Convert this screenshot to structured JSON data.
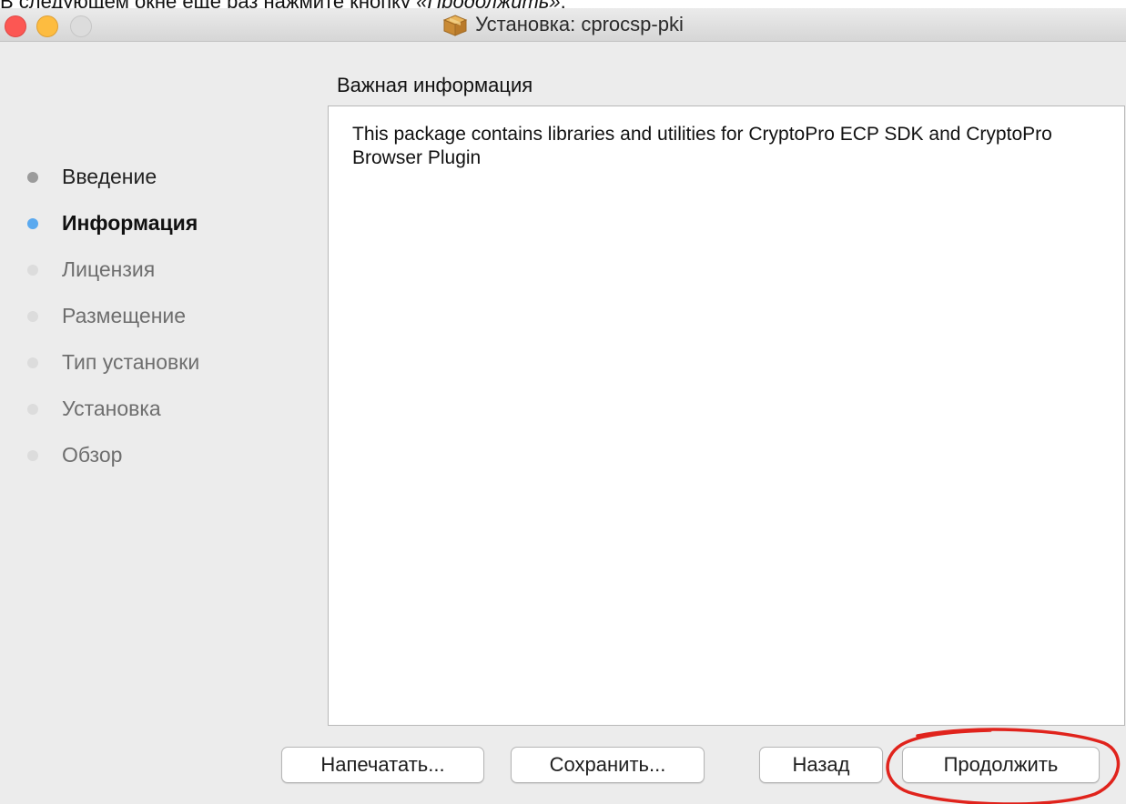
{
  "document": {
    "caption_start": "В следующем окне ещё раз нажмите кнопку ",
    "caption_emphasis": "«Продолжить»",
    "caption_end": "."
  },
  "window": {
    "title": "Установка: cprocsp-pki",
    "icon": "package-icon",
    "controls": [
      "close-icon",
      "minimize-icon",
      "maximize-icon"
    ],
    "colors": {
      "close": "#fc5753",
      "minimize": "#fdbc40",
      "maximize": "#dcdcdc"
    }
  },
  "section_heading": "Важная информация",
  "steps": [
    {
      "label": "Введение",
      "state": "done"
    },
    {
      "label": "Информация",
      "state": "active"
    },
    {
      "label": "Лицензия",
      "state": "pending"
    },
    {
      "label": "Размещение",
      "state": "pending"
    },
    {
      "label": "Тип установки",
      "state": "pending"
    },
    {
      "label": "Установка",
      "state": "pending"
    },
    {
      "label": "Обзор",
      "state": "pending"
    }
  ],
  "step_colors": {
    "done": "#9b9b9b",
    "active": "#5aa9ef",
    "pending": "#dcdcdc"
  },
  "content": {
    "text": "This package contains libraries and utilities for CryptoPro ECP SDK and CryptoPro Browser Plugin"
  },
  "buttons": {
    "print": "Напечатать...",
    "save": "Сохранить...",
    "back": "Назад",
    "continue": "Продолжить"
  },
  "annotation": {
    "shape": "ellipse",
    "target": "continue-button",
    "color": "#e0231c"
  }
}
